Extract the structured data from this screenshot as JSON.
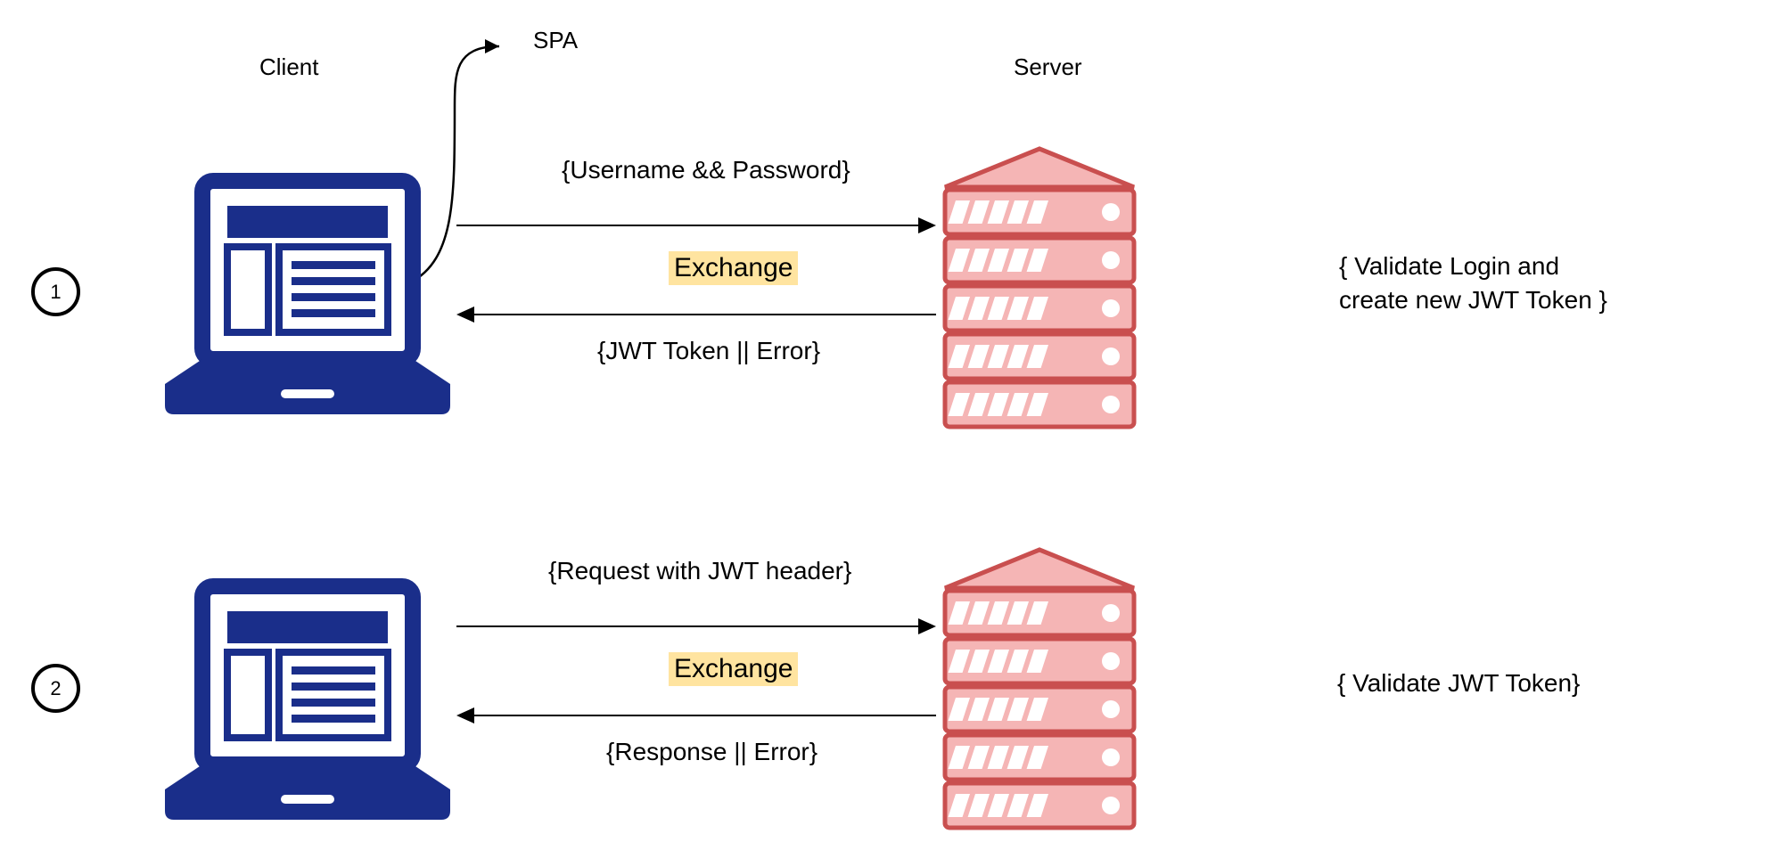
{
  "headers": {
    "client": "Client",
    "server": "Server",
    "spa": "SPA"
  },
  "steps": [
    {
      "number": "1",
      "request_label": "{Username && Password}",
      "exchange_label": "Exchange",
      "response_label": "{JWT Token || Error}",
      "server_action_line1": "{ Validate Login and",
      "server_action_line2": "create new JWT Token }"
    },
    {
      "number": "2",
      "request_label": "{Request with JWT header}",
      "exchange_label": "Exchange",
      "response_label": "{Response || Error}",
      "server_action_line1": "{ Validate JWT Token}",
      "server_action_line2": ""
    }
  ],
  "colors": {
    "laptop": "#1a2e8a",
    "server_fill": "#f5b5b5",
    "server_stroke": "#c94f4f",
    "highlight": "#ffe4a0"
  }
}
